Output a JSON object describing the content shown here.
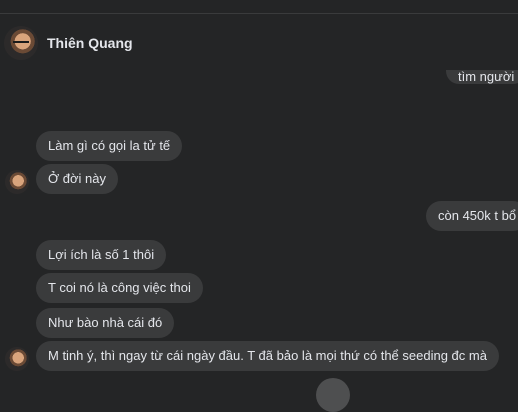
{
  "contact": {
    "name": "Thiên Quang"
  },
  "messages": [
    {
      "side": "out",
      "text": "tìm người"
    },
    {
      "side": "in",
      "text": "Làm gì có gọi la tử tế"
    },
    {
      "side": "in",
      "text": "Ở đời này"
    },
    {
      "side": "out",
      "text": "còn 450k t bổ"
    },
    {
      "side": "in",
      "text": "Lợi ích là số 1 thôi"
    },
    {
      "side": "in",
      "text": "T coi nó là công việc thoi"
    },
    {
      "side": "in",
      "text": "Như bào nhà cái đó"
    },
    {
      "side": "in",
      "text": "M tinh ý, thì ngay từ cái ngày đầu. T đã bảo là mọi thứ có thể seeding đc mà"
    }
  ]
}
